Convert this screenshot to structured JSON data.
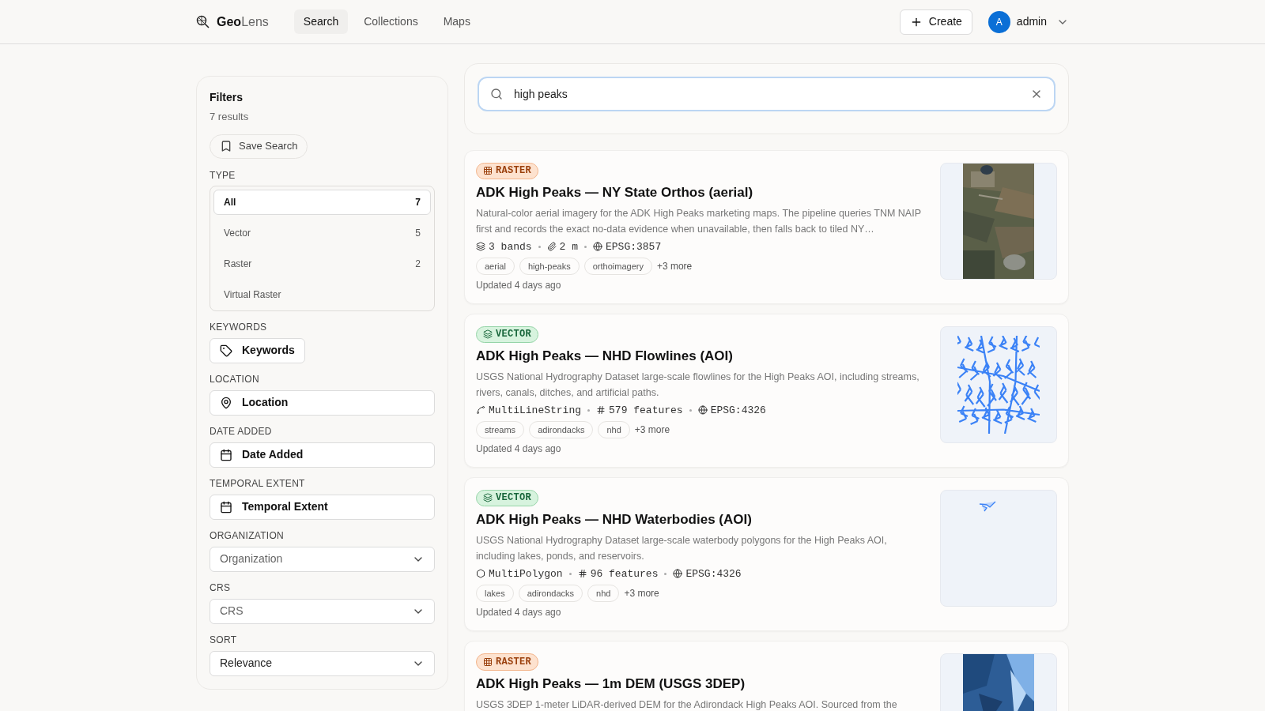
{
  "brand": {
    "bold": "Geo",
    "light": "Lens"
  },
  "nav": [
    {
      "label": "Search",
      "selected": true
    },
    {
      "label": "Collections",
      "selected": false
    },
    {
      "label": "Maps",
      "selected": false
    }
  ],
  "create_button": "Create",
  "user": {
    "initial": "A",
    "name": "admin"
  },
  "filters": {
    "title": "Filters",
    "count": "7 results",
    "save_search": "Save Search",
    "type": {
      "label": "TYPE",
      "options": [
        {
          "label": "All",
          "count": "7",
          "selected": true
        },
        {
          "label": "Vector",
          "count": "5",
          "selected": false
        },
        {
          "label": "Raster",
          "count": "2",
          "selected": false
        },
        {
          "label": "Virtual Raster",
          "selected": false
        }
      ]
    },
    "sections": [
      {
        "label": "KEYWORDS",
        "kind": "keywords",
        "value": "Keywords"
      },
      {
        "label": "LOCATION",
        "kind": "location",
        "value": "Location"
      },
      {
        "label": "DATE ADDED",
        "kind": "date",
        "value": "Date Added"
      },
      {
        "label": "TEMPORAL EXTENT",
        "kind": "date",
        "value": "Temporal Extent"
      },
      {
        "label": "ORGANIZATION",
        "kind": "select",
        "placeholder": "Organization"
      },
      {
        "label": "CRS",
        "kind": "select",
        "placeholder": "CRS"
      },
      {
        "label": "SORT",
        "kind": "select",
        "value": "Relevance"
      }
    ]
  },
  "search": {
    "value": "high peaks"
  },
  "results": [
    {
      "kind": "raster",
      "badge": "RASTER",
      "title": "ADK High Peaks — NY State Orthos (aerial)",
      "description": "Natural-color aerial imagery for the ADK High Peaks marketing maps. The pipeline queries TNM NAIP first and records the exact no-data evidence when unavailable, then falls back to tiled NY…",
      "meta": [
        {
          "kind": "bands",
          "text": "3 bands"
        },
        {
          "kind": "resolution",
          "text": "2 m"
        },
        {
          "kind": "crs",
          "text": "EPSG:3857"
        }
      ],
      "tags": [
        "aerial",
        "high-peaks",
        "orthoimagery"
      ],
      "more": "+3 more",
      "updated": "Updated 4 days ago"
    },
    {
      "kind": "vector",
      "badge": "VECTOR",
      "title": "ADK High Peaks — NHD Flowlines (AOI)",
      "description": "USGS National Hydrography Dataset large-scale flowlines for the High Peaks AOI, including streams, rivers, canals, ditches, and artificial paths.",
      "meta": [
        {
          "kind": "line",
          "text": "MultiLineString"
        },
        {
          "kind": "features",
          "text": "579 features"
        },
        {
          "kind": "crs",
          "text": "EPSG:4326"
        }
      ],
      "tags": [
        "streams",
        "adirondacks",
        "nhd"
      ],
      "more": "+3 more",
      "updated": "Updated 4 days ago"
    },
    {
      "kind": "vector",
      "badge": "VECTOR",
      "title": "ADK High Peaks — NHD Waterbodies (AOI)",
      "description": "USGS National Hydrography Dataset large-scale waterbody polygons for the High Peaks AOI, including lakes, ponds, and reservoirs.",
      "meta": [
        {
          "kind": "polygon",
          "text": "MultiPolygon"
        },
        {
          "kind": "features",
          "text": "96 features"
        },
        {
          "kind": "crs",
          "text": "EPSG:4326"
        }
      ],
      "tags": [
        "lakes",
        "adirondacks",
        "nhd"
      ],
      "more": "+3 more",
      "updated": "Updated 4 days ago"
    },
    {
      "kind": "raster",
      "badge": "RASTER",
      "title": "ADK High Peaks — 1m DEM (USGS 3DEP)",
      "description": "USGS 3DEP 1-meter LiDAR-derived DEM for the Adirondack High Peaks AOI. Sourced from the"
    }
  ]
}
